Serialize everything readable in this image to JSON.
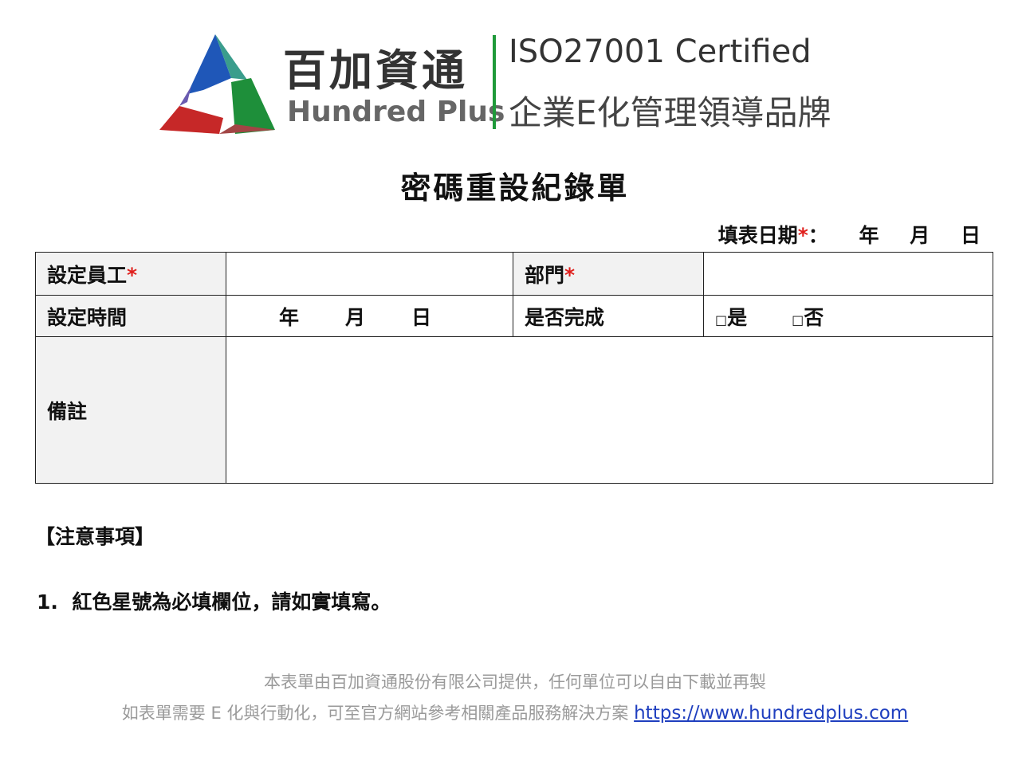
{
  "header": {
    "brand_cn": "百加資通",
    "brand_en": "Hundred Plus",
    "iso": "ISO27001 Certified",
    "slogan": "企業E化管理領導品牌"
  },
  "title": "密碼重設紀錄單",
  "fill_date": {
    "label": "填表日期",
    "required_mark": "*",
    "colon": "：",
    "year": "年",
    "month": "月",
    "day": "日"
  },
  "form": {
    "employee_label": "設定員工",
    "employee_value": "",
    "dept_label": "部門",
    "dept_value": "",
    "required_mark": "*",
    "time_label": "設定時間",
    "time_year": "年",
    "time_month": "月",
    "time_day": "日",
    "done_label": "是否完成",
    "checkbox_glyph": "□",
    "opt_yes": "是",
    "opt_no": "否",
    "remarks_label": "備註",
    "remarks_value": ""
  },
  "notice": {
    "title": "【注意事項】",
    "item_number": "1.",
    "item_text": "紅色星號為必填欄位，請如實填寫。"
  },
  "footer": {
    "line1": "本表單由百加資通股份有限公司提供，任何單位可以自由下載並再製",
    "line2": "如表單需要 E 化與行動化，可至官方網站參考相關產品服務解決方案",
    "link": "https://www.hundredplus.com"
  },
  "colors": {
    "required": "#e0201d",
    "divider_green": "#1f9a3a",
    "link": "#1f3fbf",
    "label_bg": "#f2f2f2",
    "footer_gray": "#9a9a9a"
  }
}
